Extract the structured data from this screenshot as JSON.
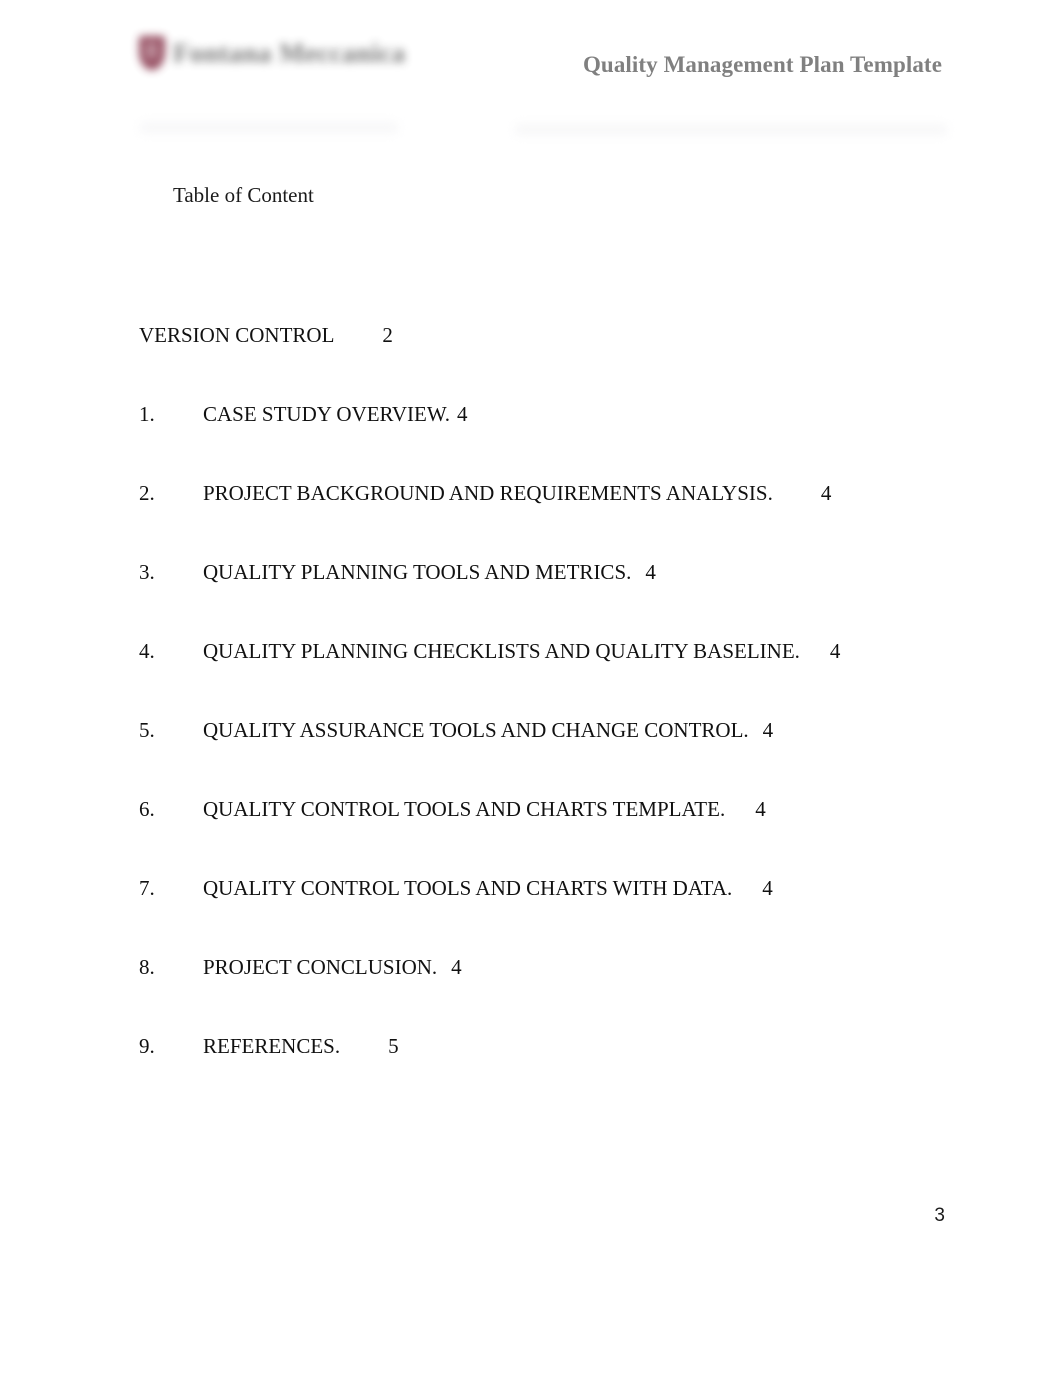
{
  "document": {
    "page_background": "#ffffff",
    "text_color": "#111111"
  },
  "header": {
    "brand_name": "Fontana Meccanica",
    "brand_mark_color": "#8c3d52",
    "brand_redacted": true,
    "title": "Quality Management Plan Template",
    "title_color": "#808080"
  },
  "body": {
    "heading": "Table of Content",
    "entries": [
      {
        "number": "",
        "label": "VERSION CONTROL",
        "page": "2"
      },
      {
        "number": "1.",
        "label": "CASE STUDY OVERVIEW.",
        "page": "4"
      },
      {
        "number": "2.",
        "label": "PROJECT BACKGROUND AND REQUIREMENTS ANALYSIS.",
        "page": "4"
      },
      {
        "number": "3.",
        "label": "QUALITY PLANNING TOOLS AND METRICS.",
        "page": "4"
      },
      {
        "number": "4.",
        "label": "QUALITY PLANNING CHECKLISTS AND QUALITY BASELINE.",
        "page": "4"
      },
      {
        "number": "5.",
        "label": "QUALITY ASSURANCE TOOLS AND CHANGE CONTROL.",
        "page": "4"
      },
      {
        "number": "6.",
        "label": "QUALITY CONTROL TOOLS AND CHARTS TEMPLATE.",
        "page": "4"
      },
      {
        "number": "7.",
        "label": "QUALITY CONTROL TOOLS AND CHARTS WITH DATA.",
        "page": "4"
      },
      {
        "number": "8.",
        "label": "PROJECT CONCLUSION.",
        "page": "4"
      },
      {
        "number": "9.",
        "label": "REFERENCES.",
        "page": "5"
      }
    ]
  },
  "footer": {
    "page_number": "3"
  }
}
